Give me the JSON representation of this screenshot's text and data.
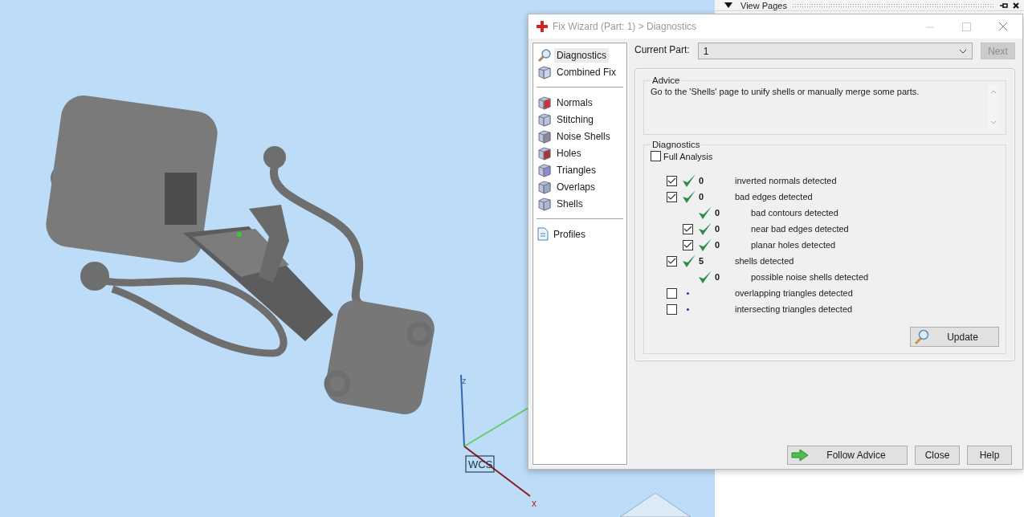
{
  "viewport": {
    "z_axis_label": "z",
    "x_axis_label": "x",
    "wcs_label": "WCS"
  },
  "side_panel": {
    "title": "View Pages"
  },
  "dialog": {
    "title": "Fix Wizard (Part: 1) > Diagnostics",
    "nav_groups": [
      [
        {
          "label": "Diagnostics",
          "selected": true
        },
        {
          "label": "Combined Fix",
          "selected": false
        }
      ],
      [
        {
          "label": "Normals",
          "selected": false
        },
        {
          "label": "Stitching",
          "selected": false
        },
        {
          "label": "Noise Shells",
          "selected": false
        },
        {
          "label": "Holes",
          "selected": false
        },
        {
          "label": "Triangles",
          "selected": false
        },
        {
          "label": "Overlaps",
          "selected": false
        },
        {
          "label": "Shells",
          "selected": false
        }
      ],
      [
        {
          "label": "Profiles",
          "selected": false
        }
      ]
    ],
    "current_part": {
      "label": "Current Part:",
      "value": "1"
    },
    "next_button": {
      "label": "Next",
      "disabled": true
    },
    "advice": {
      "title": "Advice",
      "text": "Go to the 'Shells' page to unify shells or manually merge some parts."
    },
    "diagnostics": {
      "title": "Diagnostics",
      "full_analysis": {
        "label": "Full Analysis",
        "checked": false
      },
      "rows": [
        {
          "kind": "checkable",
          "checked": true,
          "passed": true,
          "count": "0",
          "label": "inverted normals detected"
        },
        {
          "kind": "checkable",
          "checked": true,
          "passed": true,
          "count": "0",
          "label": "bad edges detected",
          "children": [
            {
              "kind": "info",
              "passed": true,
              "count": "0",
              "label": "bad contours detected"
            },
            {
              "kind": "checkable",
              "checked": true,
              "passed": true,
              "count": "0",
              "label": "near bad edges detected"
            },
            {
              "kind": "checkable",
              "checked": true,
              "passed": true,
              "count": "0",
              "label": "planar holes detected"
            }
          ]
        },
        {
          "kind": "checkable",
          "checked": true,
          "passed": true,
          "count": "5",
          "label": "shells detected",
          "children": [
            {
              "kind": "info",
              "passed": true,
              "count": "0",
              "label": "possible noise shells detected"
            }
          ]
        },
        {
          "kind": "checkable",
          "checked": false,
          "passed": false,
          "label": "overlapping triangles detected"
        },
        {
          "kind": "checkable",
          "checked": false,
          "passed": false,
          "label": "intersecting triangles detected"
        }
      ],
      "update_button": "Update"
    },
    "buttons": [
      "Follow Advice",
      "Close",
      "Help"
    ]
  }
}
